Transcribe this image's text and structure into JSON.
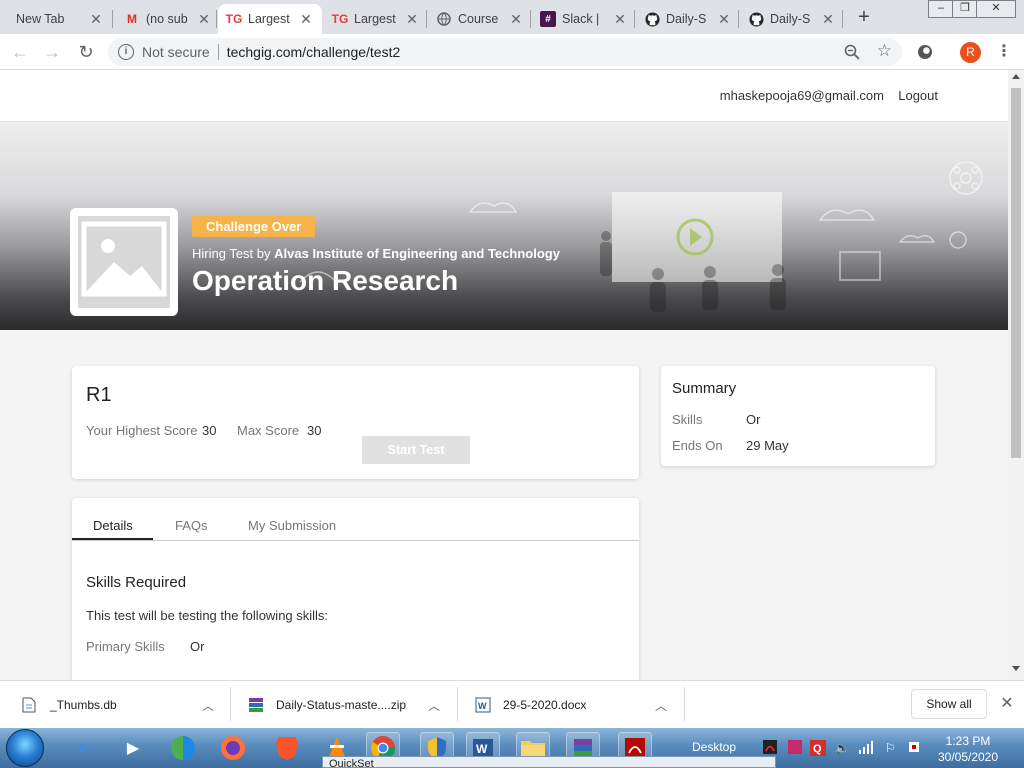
{
  "browser": {
    "tabs": [
      {
        "label": "New Tab",
        "icon": "blank"
      },
      {
        "label": "(no sub",
        "icon": "gmail-icon"
      },
      {
        "label": "Largest",
        "icon": "techgig-icon",
        "active": true
      },
      {
        "label": "Largest",
        "icon": "techgig-icon"
      },
      {
        "label": "Course",
        "icon": "globe-icon"
      },
      {
        "label": "Slack |",
        "icon": "slack-icon"
      },
      {
        "label": "Daily-S",
        "icon": "github-icon"
      },
      {
        "label": "Daily-S",
        "icon": "github-icon"
      }
    ],
    "tab_close": "✕",
    "new_tab": "+",
    "address": {
      "security": "Not secure",
      "url": "techgig.com/challenge/test2"
    },
    "profile_initial": "R"
  },
  "site": {
    "email": "mhaskepooja69@gmail.com",
    "logout": "Logout"
  },
  "challenge": {
    "status": "Challenge Over",
    "hiring_prefix": "Hiring Test by",
    "organizer": "Alvas Institute of Engineering and Technology",
    "title": "Operation Research"
  },
  "round": {
    "name": "R1",
    "highest_score_label": "Your Highest Score",
    "highest_score": "30",
    "max_score_label": "Max Score",
    "max_score": "30",
    "start_button": "Start Test"
  },
  "summary": {
    "title": "Summary",
    "skills_label": "Skills",
    "skills_value": "Or",
    "ends_label": "Ends On",
    "ends_value": "29 May"
  },
  "details": {
    "tabs": [
      "Details",
      "FAQs",
      "My Submission"
    ],
    "skills_title": "Skills Required",
    "skills_desc": "This test will be testing the following skills:",
    "primary_label": "Primary Skills",
    "primary_value": "Or"
  },
  "downloads": {
    "items": [
      "_Thumbs.db",
      "Daily-Status-maste....zip",
      "29-5-2020.docx"
    ],
    "show_all": "Show all"
  },
  "taskbar": {
    "desktop_label": "Desktop",
    "time": "1:23 PM",
    "date": "30/05/2020",
    "quickset": "QuickSet"
  },
  "colors": {
    "status_pill": "#f7b24a",
    "profile": "#e8501e"
  }
}
